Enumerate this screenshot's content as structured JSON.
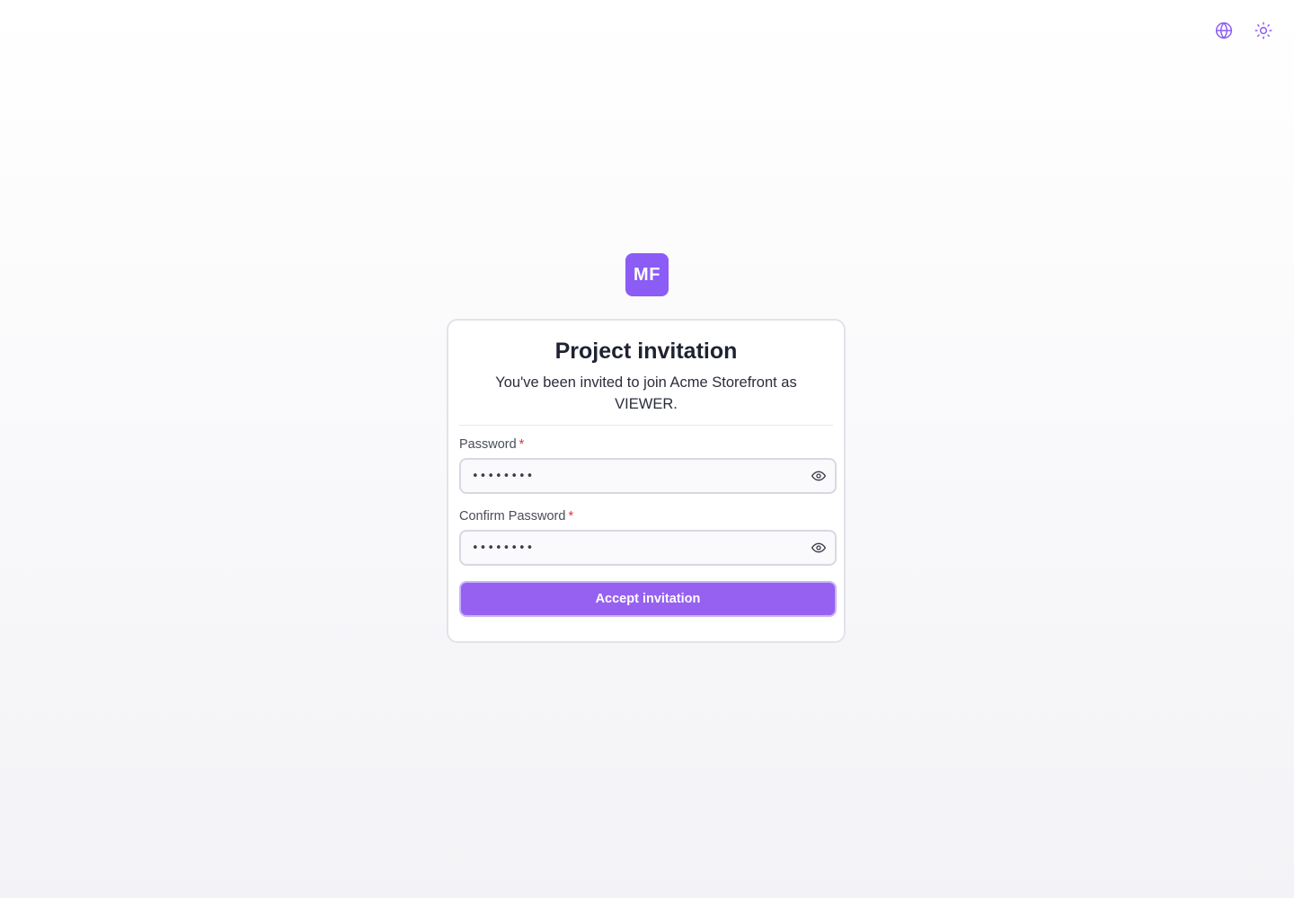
{
  "header": {
    "language_icon": "globe-icon",
    "theme_icon": "sun-icon"
  },
  "brand": {
    "logo_text": "MF",
    "color": "#8b5cf6"
  },
  "card": {
    "title": "Project invitation",
    "subtitle": "You've been invited to join Acme Storefront as VIEWER."
  },
  "form": {
    "password": {
      "label": "Password",
      "required_mark": "*",
      "value": "••••••••",
      "toggle_icon": "eye-icon"
    },
    "confirm_password": {
      "label": "Confirm Password",
      "required_mark": "*",
      "value": "••••••••",
      "toggle_icon": "eye-icon"
    },
    "submit_label": "Accept invitation"
  }
}
